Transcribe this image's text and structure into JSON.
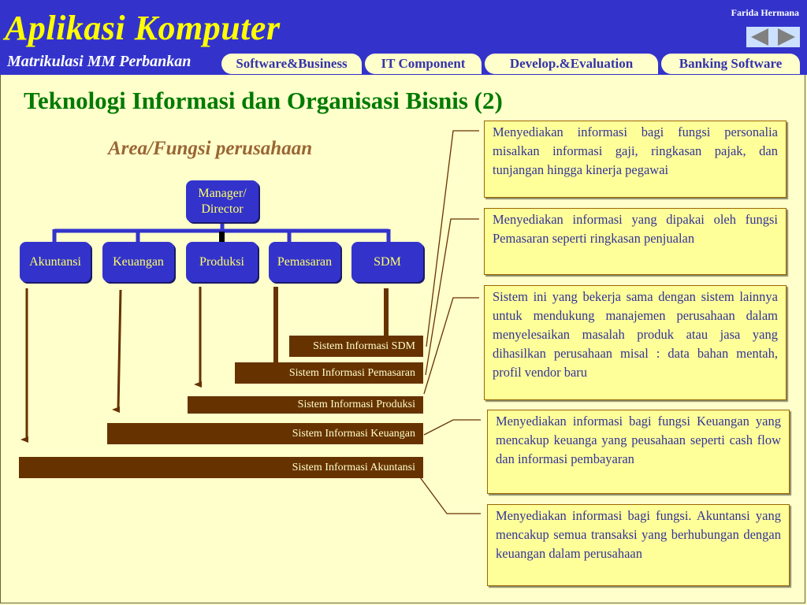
{
  "header": {
    "app_title": "Aplikasi Komputer",
    "subtitle": "Matrikulasi MM Perbankan",
    "author": "Farida Hermana",
    "nav": {
      "prev_icon": "triangle-left",
      "next_icon": "triangle-right"
    },
    "tabs": [
      {
        "label": "Software&Business"
      },
      {
        "label": "IT Component"
      },
      {
        "label": "Develop.&Evaluation"
      },
      {
        "label": "Banking Software"
      }
    ]
  },
  "colors": {
    "header_bg": "#3333cc",
    "title_yellow": "#ffff00",
    "page_bg": "#ffffcc",
    "page_title": "#007a00",
    "org_box": "#3333cc",
    "system_bar": "#663300",
    "note_bg": "#ffff99",
    "note_text": "#333399"
  },
  "page_title": "Teknologi Informasi dan Organisasi Bisnis (2)",
  "diagram": {
    "title": "Area/Fungsi perusahaan",
    "root": {
      "line1": "Manager/",
      "line2": "Director"
    },
    "departments": [
      {
        "label": "Akuntansi"
      },
      {
        "label": "Keuangan"
      },
      {
        "label": "Produksi"
      },
      {
        "label": "Pemasaran"
      },
      {
        "label": "SDM"
      }
    ],
    "systems": [
      {
        "label": "Sistem Informasi SDM"
      },
      {
        "label": "Sistem Informasi Pemasaran"
      },
      {
        "label": "Sistem Informasi Produksi"
      },
      {
        "label": "Sistem Informasi Keuangan"
      },
      {
        "label": "Sistem Informasi Akuntansi"
      }
    ],
    "notes": [
      {
        "text": "Menyediakan informasi bagi fungsi personalia misalkan informasi gaji, ringkasan pajak, dan tunjangan hingga kinerja pegawai"
      },
      {
        "text": "Menyediakan informasi yang dipakai oleh fungsi Pemasaran seperti ringkasan penjualan"
      },
      {
        "text": "Sistem ini yang bekerja sama dengan sistem lainnya untuk mendukung manajemen perusahaan dalam menyelesaikan masalah produk atau jasa yang dihasilkan perusahaan misal : data bahan mentah, profil vendor baru"
      },
      {
        "text": "Menyediakan informasi bagi fungsi Keuangan yang mencakup keuanga yang peusahaan seperti cash flow dan informasi pembayaran"
      },
      {
        "text": "Menyediakan informasi bagi fungsi. Akuntansi yang mencakup semua transaksi yang berhubungan dengan keuangan dalam perusahaan"
      }
    ]
  }
}
